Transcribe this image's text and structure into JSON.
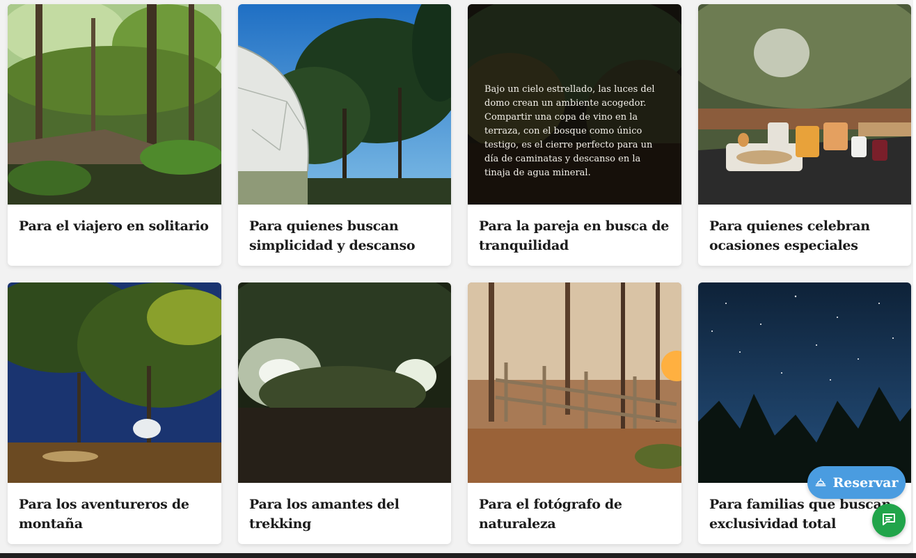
{
  "cards": [
    {
      "title": "Para el viajero en solitario",
      "image": "forest-trail-photo"
    },
    {
      "title": "Para quienes buscan simplicidad y descanso",
      "image": "dome-under-trees-photo"
    },
    {
      "title": "Para la pareja en busca de tranquilidad",
      "image": "night-dome-photo",
      "caption": "Bajo un cielo estrellado, las luces del domo crean un ambiente acogedor. Compartir una copa de vino en la terraza, con el bosque como único testigo, es el cierre perfecto para un día de caminatas y descanso en la tinaja de agua mineral."
    },
    {
      "title": "Para quienes celebran ocasiones especiales",
      "image": "breakfast-table-photo"
    },
    {
      "title": "Para los aventureros de montaña",
      "image": "campsite-night-photo"
    },
    {
      "title": "Para los amantes del trekking",
      "image": "lit-domes-forest-photo"
    },
    {
      "title": "Para el fotógrafo de naturaleza",
      "image": "sunset-fence-photo"
    },
    {
      "title": "Para familias que buscan exclusividad total",
      "image": "starry-sky-photo"
    }
  ],
  "reserve_button": {
    "label": "Reservar",
    "icon": "bell-icon"
  },
  "chat_button": {
    "icon": "chat-icon"
  },
  "colors": {
    "reserve": "#4a9ce0",
    "chat": "#21a44a"
  }
}
